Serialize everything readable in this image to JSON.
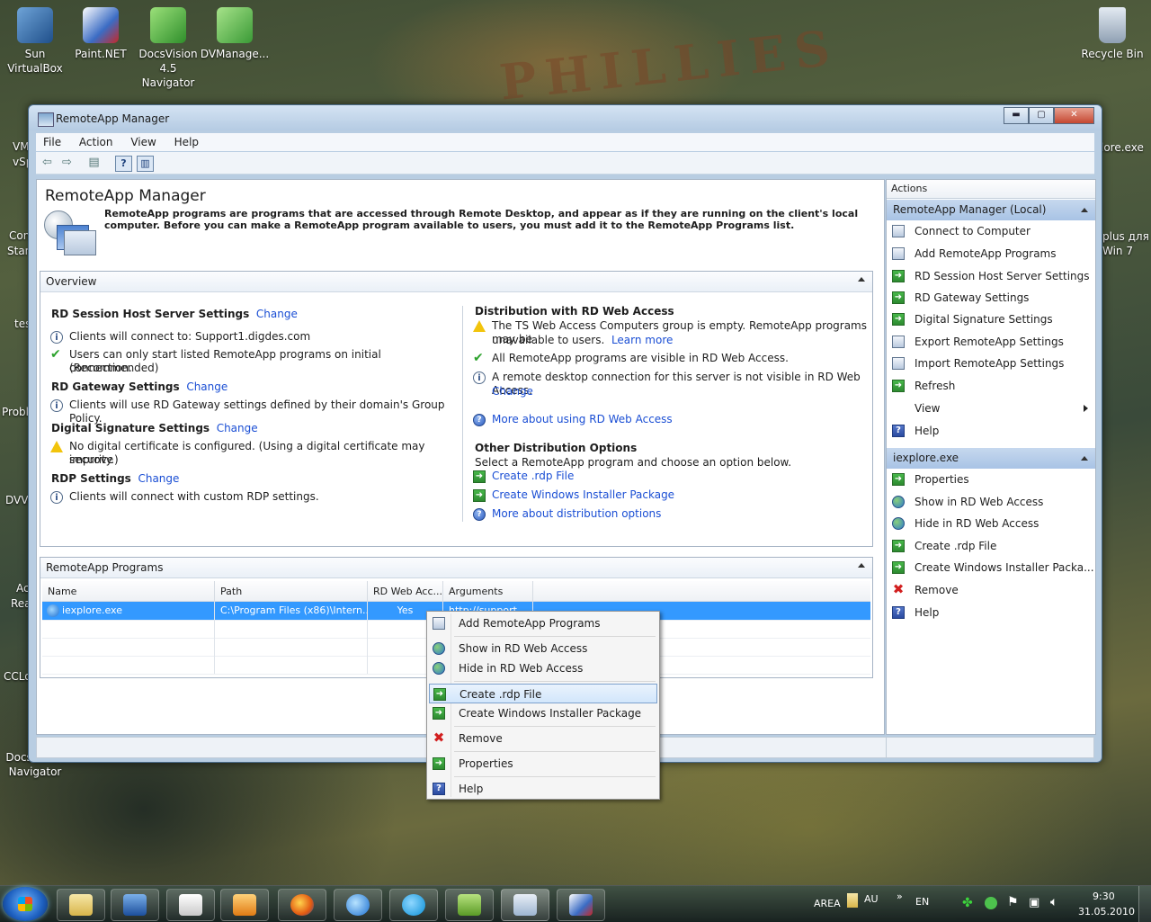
{
  "desktop": {
    "icons": [
      {
        "label": "Sun VirtualBox"
      },
      {
        "label": "Paint.NET"
      },
      {
        "label": "DocsVision 4.5 Navigator"
      },
      {
        "label": "DVManage..."
      },
      {
        "label": "Recycle Bin"
      },
      {
        "label": "DocsVision Navigator"
      }
    ],
    "partial": [
      "VM",
      "vSp",
      "Con",
      "Stan",
      "tes",
      "Probl",
      "DVVi",
      "Ac",
      "Rea",
      "CCLo",
      "lore.exe",
      "plus для",
      "Win 7"
    ]
  },
  "window": {
    "title": "RemoteApp Manager",
    "controls": {
      "minimize": "▬",
      "maximize": "▢",
      "close": "✕"
    }
  },
  "menu": [
    "File",
    "Action",
    "Help",
    "View"
  ],
  "menu_order": {
    "file": "File",
    "action": "Action",
    "view": "View",
    "help": "Help"
  },
  "content": {
    "title": "RemoteApp Manager",
    "intro": "RemoteApp programs are programs that are accessed through Remote Desktop, and appear as if they are running on the client's local computer. Before you can make a RemoteApp program available to users, you must add it to the RemoteApp Programs list."
  },
  "overview": {
    "title": "Overview",
    "rdsh": {
      "heading": "RD Session Host Server Settings",
      "link": "Change",
      "items": [
        "Clients will connect to: Support1.digdes.com",
        "Users can only start listed RemoteApp programs on initial connection.",
        "(Recommended)"
      ]
    },
    "gateway": {
      "heading": "RD Gateway Settings",
      "link": "Change",
      "items": [
        "Clients will use RD Gateway settings defined by their domain's Group Policy."
      ]
    },
    "signature": {
      "heading": "Digital Signature Settings",
      "link": "Change",
      "items": [
        "No digital certificate is configured. (Using a digital certificate may improve",
        "security.)"
      ]
    },
    "rdp": {
      "heading": "RDP Settings",
      "link": "Change",
      "items": [
        "Clients will connect with custom RDP settings."
      ]
    },
    "distribution": {
      "heading": "Distribution with RD Web Access",
      "warn_line1": "The TS Web Access Computers group is empty. RemoteApp programs may be",
      "warn_line2": "unavailable to users.",
      "learn_more": "Learn more",
      "visible": "All RemoteApp programs are visible in RD Web Access.",
      "rdc_line": "A remote desktop connection for this server is not visible in RD Web Access.",
      "change": "Change",
      "more_link": "More about using RD Web Access"
    },
    "other": {
      "heading": "Other Distribution Options",
      "desc": "Select a RemoteApp program and choose an option below.",
      "links": [
        "Create .rdp File",
        "Create Windows Installer Package",
        "More about distribution options"
      ]
    }
  },
  "programs": {
    "title": "RemoteApp Programs",
    "columns": [
      "Name",
      "Path",
      "RD Web Acc...",
      "Arguments"
    ],
    "rows": [
      {
        "name": "iexplore.exe",
        "path": "C:\\Program Files (x86)\\Intern...",
        "webaccess": "Yes",
        "arguments": "http://support..."
      }
    ]
  },
  "actions": {
    "header": "Actions",
    "group1": {
      "title": "RemoteApp Manager (Local)",
      "items": [
        "Connect to Computer",
        "Add RemoteApp Programs",
        "RD Session Host Server Settings",
        "RD Gateway Settings",
        "Digital Signature Settings",
        "Export RemoteApp Settings",
        "Import RemoteApp Settings",
        "Refresh",
        "View",
        "Help"
      ]
    },
    "group2": {
      "title": "iexplore.exe",
      "items": [
        "Properties",
        "Show in RD Web Access",
        "Hide in RD Web Access",
        "Create .rdp File",
        "Create Windows Installer Packa...",
        "Remove",
        "Help"
      ]
    }
  },
  "context_menu": {
    "items": [
      "Add RemoteApp Programs",
      "Show in RD Web Access",
      "Hide in RD Web Access",
      "Create .rdp File",
      "Create Windows Installer Package",
      "Remove",
      "Properties",
      "Help"
    ],
    "highlighted": "Create .rdp File"
  },
  "taskbar": {
    "tray": {
      "area": "AREA",
      "au": "AU",
      "lang": "EN",
      "time": "9:30",
      "date": "31.05.2010"
    }
  },
  "colors": {
    "link": "#1a4ed4",
    "selection": "#3399ff",
    "group_header": "#b4cbe8"
  }
}
